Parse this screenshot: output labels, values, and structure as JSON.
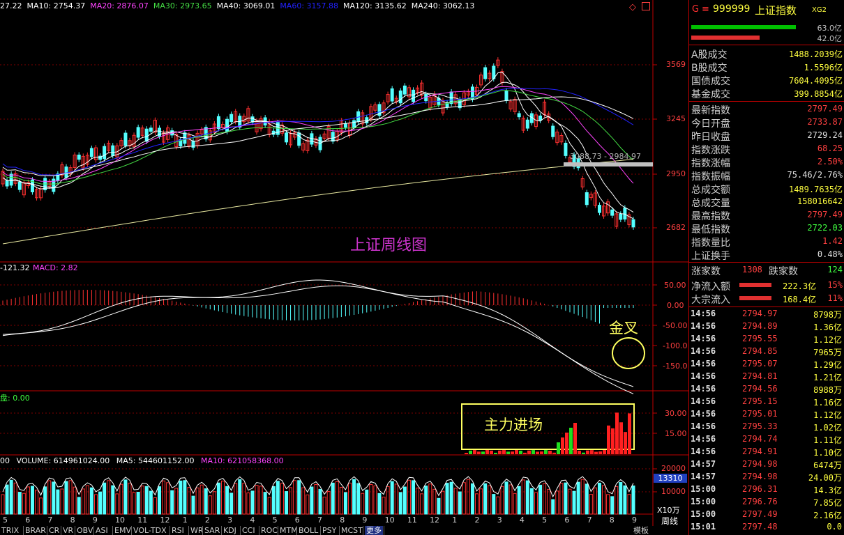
{
  "ma_header": [
    {
      "text": "27.22",
      "color": "#ffffff"
    },
    {
      "text": "MA10: 2754.37",
      "color": "#ffffff"
    },
    {
      "text": "MA20: 2876.07",
      "color": "#ff44ff"
    },
    {
      "text": "MA30: 2973.65",
      "color": "#44dd44"
    },
    {
      "text": "MA40: 3069.01",
      "color": "#ffffff"
    },
    {
      "text": "MA60: 3157.88",
      "color": "#2222ff"
    },
    {
      "text": "MA120: 3135.62",
      "color": "#ffffff"
    },
    {
      "text": "MA240: 3062.13",
      "color": "#ffffff"
    }
  ],
  "price_axis": [
    "3569",
    "3245",
    "2950",
    "2682"
  ],
  "macd_header": {
    "left": "-121.32",
    "macd": "MACD: 2.82"
  },
  "macd_axis": [
    "50.00",
    "0.00",
    "-50.00",
    "-100.0",
    "-150.0"
  ],
  "flow_header": "盘: 0.00",
  "flow_axis": [
    "30.00",
    "15.00"
  ],
  "volume_header": {
    "a": "00",
    "volume": "VOLUME: 614961024.00",
    "ma5": "MA5: 544601152.00",
    "ma10": "MA10: 621058368.00"
  },
  "volume_axis": [
    "20000",
    "13310",
    "10000",
    "X10万"
  ],
  "period_label": "周线",
  "x_labels": [
    "5",
    "6",
    "7",
    "8",
    "9",
    "10",
    "11",
    "12",
    "1",
    "2",
    "3",
    "4",
    "5",
    "6",
    "7",
    "8",
    "9",
    "10",
    "11",
    "12",
    "1",
    "2",
    "3",
    "4",
    "5",
    "6",
    "7",
    "8",
    "9"
  ],
  "annotations": {
    "chart_title": "上证周线图",
    "golden_cross": "金叉",
    "main_force": "主力进场",
    "price_box": "3088.73 - 2984.97"
  },
  "tabs": [
    "TRIX",
    "BRAR",
    "CR",
    "VR",
    "OBV",
    "ASI",
    "EMV",
    "VOL-TDX",
    "RSI",
    "WR",
    "SAR",
    "KDJ",
    "CCI",
    "ROC",
    "MTM",
    "BOLL",
    "PSY",
    "MCST",
    "更多"
  ],
  "tab_right": "模板",
  "panel": {
    "g": "G",
    "menu": "≡",
    "code": "999999",
    "name": "上证指数",
    "tag": "XG2",
    "bar1_label": "63.0亿",
    "bar2_label": "42.0亿",
    "rows_top": [
      {
        "label": "A股成交",
        "value": "1488.2039亿",
        "color": "#ffff40"
      },
      {
        "label": "B股成交",
        "value": "1.5596亿",
        "color": "#ffff40"
      },
      {
        "label": "国债成交",
        "value": "7604.4095亿",
        "color": "#ffff40"
      },
      {
        "label": "基金成交",
        "value": "399.8854亿",
        "color": "#ffff40"
      }
    ],
    "rows_mid": [
      {
        "label": "最新指数",
        "value": "2797.49",
        "color": "#ff4040"
      },
      {
        "label": "今日开盘",
        "value": "2733.87",
        "color": "#ff4040"
      },
      {
        "label": "昨日收盘",
        "value": "2729.24",
        "color": "#e0e0e0"
      },
      {
        "label": "指数涨跌",
        "value": "68.25",
        "color": "#ff4040"
      },
      {
        "label": "指数涨幅",
        "value": "2.50%",
        "color": "#ff4040"
      },
      {
        "label": "指数振幅",
        "value": "75.46/2.76%",
        "color": "#e0e0e0"
      },
      {
        "label": "总成交额",
        "value": "1489.7635亿",
        "color": "#ffff40"
      },
      {
        "label": "总成交量",
        "value": "158016642",
        "color": "#ffff40"
      },
      {
        "label": "最高指数",
        "value": "2797.49",
        "color": "#ff4040"
      },
      {
        "label": "最低指数",
        "value": "2722.03",
        "color": "#40ff40"
      },
      {
        "label": "指数量比",
        "value": "1.42",
        "color": "#ff4040"
      },
      {
        "label": "上证换手",
        "value": "0.48%",
        "color": "#e0e0e0"
      }
    ],
    "up_label": "涨家数",
    "up_value": "1308",
    "down_label": "跌家数",
    "down_value": "124",
    "flow_rows": [
      {
        "label": "净流入额",
        "value": "222.3亿",
        "pct": "15%"
      },
      {
        "label": "大宗流入",
        "value": "168.4亿",
        "pct": "11%"
      }
    ],
    "ticks": [
      {
        "time": "14:56",
        "price": "2794.97",
        "vol": "8798万"
      },
      {
        "time": "14:56",
        "price": "2794.89",
        "vol": "1.36亿"
      },
      {
        "time": "14:56",
        "price": "2795.55",
        "vol": "1.12亿"
      },
      {
        "time": "14:56",
        "price": "2794.85",
        "vol": "7965万"
      },
      {
        "time": "14:56",
        "price": "2795.07",
        "vol": "1.29亿"
      },
      {
        "time": "14:56",
        "price": "2794.81",
        "vol": "1.21亿"
      },
      {
        "time": "14:56",
        "price": "2794.56",
        "vol": "8988万"
      },
      {
        "time": "14:56",
        "price": "2795.15",
        "vol": "1.16亿"
      },
      {
        "time": "14:56",
        "price": "2795.01",
        "vol": "1.12亿"
      },
      {
        "time": "14:56",
        "price": "2795.33",
        "vol": "1.02亿"
      },
      {
        "time": "14:56",
        "price": "2794.74",
        "vol": "1.11亿"
      },
      {
        "time": "14:56",
        "price": "2794.91",
        "vol": "1.10亿"
      },
      {
        "time": "14:57",
        "price": "2794.98",
        "vol": "6474万"
      },
      {
        "time": "14:57",
        "price": "2794.98",
        "vol": "24.00万"
      },
      {
        "time": "15:00",
        "price": "2796.31",
        "vol": "14.3亿"
      },
      {
        "time": "15:00",
        "price": "2796.76",
        "vol": "7.85亿"
      },
      {
        "time": "15:00",
        "price": "2797.49",
        "vol": "2.16亿"
      },
      {
        "time": "15:01",
        "price": "2797.48",
        "vol": "0.0"
      }
    ]
  },
  "colors": {
    "up": "#ff3030",
    "down": "#54ffff",
    "grid": "#800000",
    "border": "#c00000",
    "ma_yellow": "#e8e8a0"
  }
}
